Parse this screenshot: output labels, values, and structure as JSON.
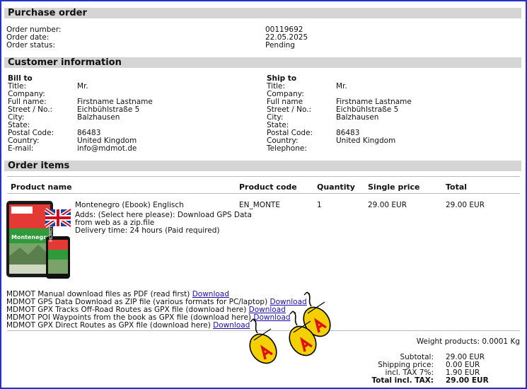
{
  "purchase_order": {
    "title": "Purchase order",
    "order_number_label": "Order number:",
    "order_number": "00119692",
    "order_date_label": "Order date:",
    "order_date": "22.05.2025",
    "order_status_label": "Order status:",
    "order_status": "Pending"
  },
  "customer": {
    "title": "Customer information",
    "bill_to": {
      "heading": "Bill to",
      "rows": [
        {
          "label": "Title:",
          "value": "Mr."
        },
        {
          "label": "Company:",
          "value": ""
        },
        {
          "label": "Full name:",
          "value": "Firstname Lastname"
        },
        {
          "label": "Street / No.:",
          "value": "Eichbühlstraße 5"
        },
        {
          "label": "City:",
          "value": "Balzhausen"
        },
        {
          "label": "State:",
          "value": ""
        },
        {
          "label": "Postal Code:",
          "value": "86483"
        },
        {
          "label": "Country:",
          "value": "United Kingdom"
        },
        {
          "label": "E-mail:",
          "value": "info@mdmot.de"
        }
      ]
    },
    "ship_to": {
      "heading": "Ship to",
      "rows": [
        {
          "label": "Title:",
          "value": "Mr."
        },
        {
          "label": "Company:",
          "value": ""
        },
        {
          "label": "Full name",
          "value": "Firstname Lastname"
        },
        {
          "label": "Street / No.:",
          "value": "Eichbühlstraße 5"
        },
        {
          "label": "City:",
          "value": "Balzhausen"
        },
        {
          "label": "State:",
          "value": ""
        },
        {
          "label": "Postal Code:",
          "value": "86483"
        },
        {
          "label": "Country:",
          "value": "United Kingdom"
        },
        {
          "label": "Telephone:",
          "value": ""
        }
      ]
    }
  },
  "order_items": {
    "title": "Order items",
    "columns": {
      "product_name": "Product name",
      "product_code": "Product code",
      "quantity": "Quantity",
      "single_price": "Single price",
      "total": "Total"
    },
    "item": {
      "name": "Montenegro (Ebook) Englisch",
      "adds_line1": "Adds: (Select here please): Download GPS Data",
      "adds_line2": "from web as a zip.file",
      "delivery": "Delivery time: 24 hours (Paid required)",
      "code": "EN_MONTE",
      "quantity": "1",
      "single_price": "29.00 EUR",
      "total": "29.00 EUR",
      "cover_text": "Montenegro"
    },
    "downloads": [
      {
        "text": "MDMOT Manual download files as PDF (read first)",
        "link": "Download"
      },
      {
        "text": "MDMOT GPS Data Download as ZIP file (various formats for PC/laptop)",
        "link": "Download"
      },
      {
        "text": "MDMOT GPX Tracks Off-Road Routes as GPX file (download here)",
        "link": "Download"
      },
      {
        "text": "MDMOT POI Waypoints from the book as GPX file (download here)",
        "link": "Download"
      },
      {
        "text": "MDMOT GPX Direct Routes as GPX file (download here)",
        "link": "Download"
      }
    ],
    "weight_label": "Weight products: 0.0001 Kg"
  },
  "totals": {
    "subtotal_label": "Subtotal:",
    "subtotal": "29.00 EUR",
    "shipping_label": "Shipping price:",
    "shipping": "0.00 EUR",
    "tax_label": "incl. TAX 7%:",
    "tax": "1.90 EUR",
    "total_label": "Total incl. TAX:",
    "total": "29.00 EUR"
  },
  "colors": {
    "frame": "#2233cc",
    "section_bg": "#d5d5d5",
    "link": "#1a0dab",
    "mouse_yellow": "#f5d000",
    "mouse_red": "#dd1111"
  }
}
